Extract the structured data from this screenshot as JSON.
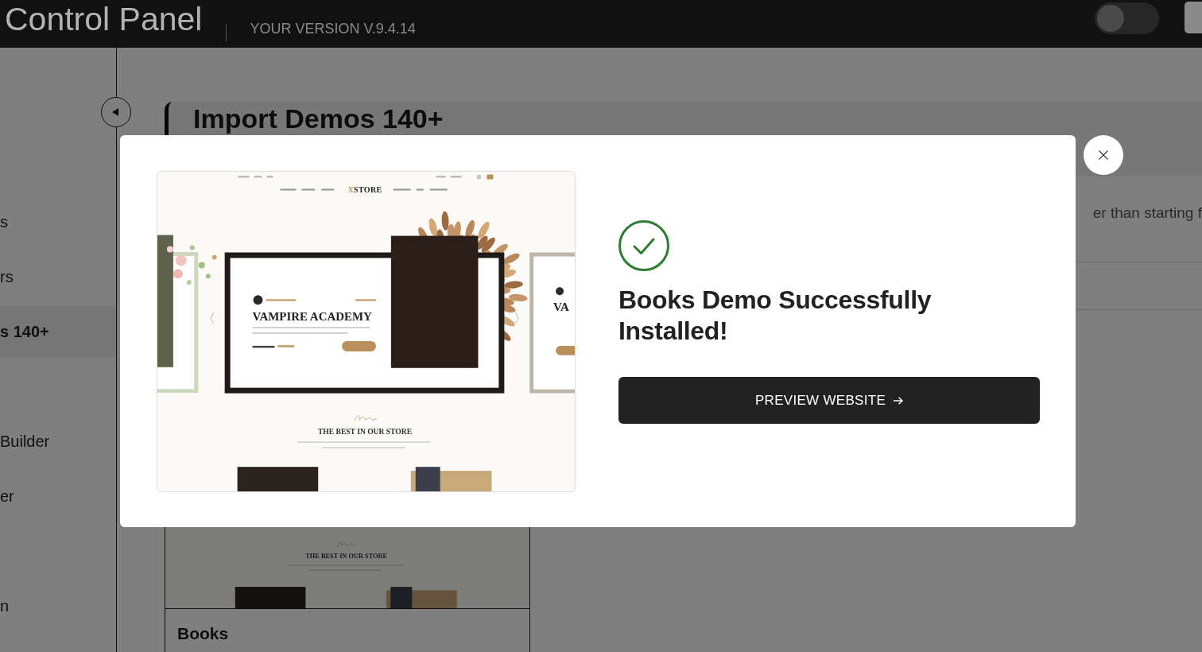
{
  "header": {
    "title": "Control Panel",
    "version": "YOUR VERSION V.9.4.14",
    "theme_toggle": {
      "on": false
    }
  },
  "sidebar": {
    "groups": [
      {
        "items": [
          {
            "label": "s",
            "selected": false
          },
          {
            "label": "rs",
            "selected": false
          },
          {
            "label": "s 140+",
            "selected": true
          }
        ]
      },
      {
        "items": [
          {
            "label": "Builder",
            "selected": false
          },
          {
            "label": "er",
            "selected": false
          }
        ]
      },
      {
        "items": [
          {
            "label": "n",
            "selected": false
          }
        ]
      }
    ]
  },
  "page": {
    "heading": "Import Demos 140+",
    "description": "er than starting f"
  },
  "demos": [
    {
      "title": "Books",
      "preview": {
        "section_title": "THE BEST IN OUR STORE"
      }
    }
  ],
  "modal": {
    "preview": {
      "logo": "XSTORE",
      "hero_title": "VAMPIRE ACADEMY",
      "next_slide_title": "VA",
      "section_title": "THE BEST IN OUR STORE"
    },
    "title": "Books Demo Successfully Installed!",
    "button": "PREVIEW WEBSITE"
  }
}
